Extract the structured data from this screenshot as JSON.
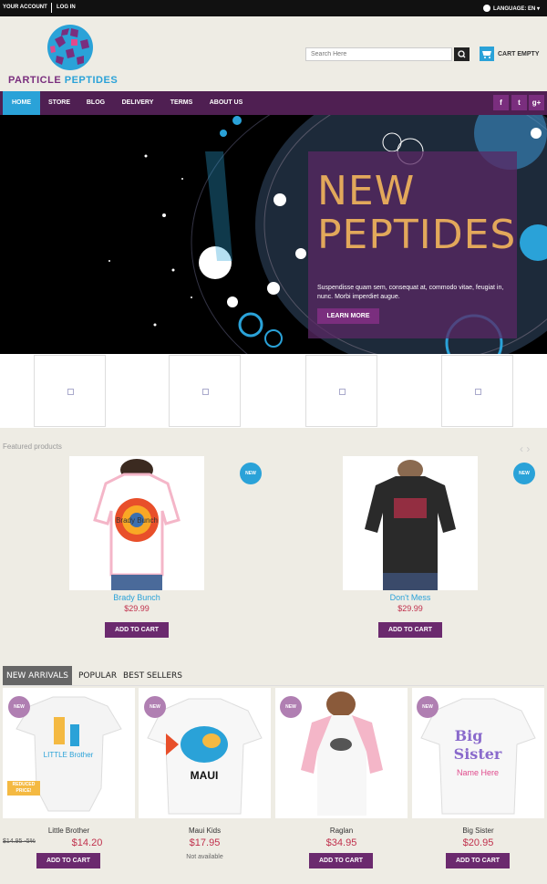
{
  "topbar": {
    "account": "YOUR ACCOUNT",
    "login": "LOG IN",
    "language": "LANGUAGE:  EN ▾"
  },
  "header": {
    "logo_word_1": "PARTICLE",
    "logo_word_2": "PEPTIDES",
    "search_placeholder": "Search Here",
    "cart_label": "CART EMPTY"
  },
  "nav": {
    "items": [
      "HOME",
      "STORE",
      "BLOG",
      "DELIVERY",
      "TERMS",
      "ABOUT US"
    ]
  },
  "social": {
    "facebook": "f",
    "twitter": "t",
    "google": "g+"
  },
  "hero": {
    "title_line1": "NEW",
    "title_line2": "PEPTIDES",
    "text": "Suspendisse quam sem, consequat at, commodo vitae, feugiat in, nunc. Morbi imperdiet augue.",
    "button": "LEARN MORE"
  },
  "featured": {
    "label": "Featured products",
    "badge": "NEW",
    "items": [
      {
        "name": "Brady Bunch",
        "price": "$29.99",
        "button": "ADD TO CART"
      },
      {
        "name": "Don't Mess",
        "price": "$29.99",
        "button": "ADD TO CART"
      }
    ]
  },
  "tabs": [
    "NEW ARRIVALS",
    "POPULAR",
    "BEST SELLERS"
  ],
  "grid": {
    "badge": "NEW",
    "reduced": "REDUCED PRICE!",
    "items": [
      {
        "name": "Little Brother",
        "price": "$14.20",
        "old_price": "$14.95",
        "discount": "-5%",
        "button": "ADD TO CART"
      },
      {
        "name": "Maui Kids",
        "price": "$17.95",
        "availability": "Not available"
      },
      {
        "name": "Raglan",
        "price": "$34.95",
        "button": "ADD TO CART"
      },
      {
        "name": "Big Sister",
        "price": "$20.95",
        "button": "ADD TO CART"
      }
    ],
    "shirt_texts": {
      "little_brother": "LITTLE Brother",
      "maui": "MAUI",
      "big_sister_1": "Big",
      "big_sister_2": "Sister",
      "big_sister_3": "Name Here",
      "brady": "Brady Bunch"
    }
  },
  "colors": {
    "brand_purple": "#4f1f52",
    "accent_blue": "#2aa2d8",
    "price_red": "#c0304c",
    "gold": "#e2a85b"
  }
}
